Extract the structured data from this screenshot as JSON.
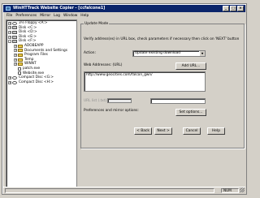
{
  "window": {
    "title": "WinHTTrack Website Copier - [ccfalcone1]"
  },
  "menu": [
    "File",
    "Preferences",
    "Mirror",
    "Log",
    "Window",
    "Help"
  ],
  "tree": [
    {
      "label": "3½ Floppy <A:>",
      "level": 0,
      "toggle": "+",
      "icon": "floppy",
      "selected": false
    },
    {
      "label": "Disk <C:>",
      "level": 0,
      "toggle": "+",
      "icon": "drive",
      "selected": false
    },
    {
      "label": "Disk <D:>",
      "level": 0,
      "toggle": "+",
      "icon": "drive",
      "selected": false
    },
    {
      "label": "Disk <E:>",
      "level": 0,
      "toggle": "+",
      "icon": "drive",
      "selected": false
    },
    {
      "label": "Disk <F:>",
      "level": 0,
      "toggle": "-",
      "icon": "drive",
      "selected": false
    },
    {
      "label": "ADOBEAPP",
      "level": 1,
      "toggle": "+",
      "icon": "folder",
      "selected": false
    },
    {
      "label": "Documents and Settings",
      "level": 1,
      "toggle": "+",
      "icon": "folder",
      "selected": false
    },
    {
      "label": "Program Files",
      "level": 1,
      "toggle": "+",
      "icon": "folder",
      "selected": false
    },
    {
      "label": "Temp",
      "level": 1,
      "toggle": "+",
      "icon": "folder",
      "selected": false
    },
    {
      "label": "WINNT",
      "level": 1,
      "toggle": "+",
      "icon": "folder",
      "selected": false
    },
    {
      "label": "patch.exe",
      "level": 1,
      "toggle": "",
      "icon": "file",
      "selected": false
    },
    {
      "label": "Website.exe",
      "level": 1,
      "toggle": "",
      "icon": "file",
      "selected": false
    },
    {
      "label": "Compact Disc <G:>",
      "level": 0,
      "toggle": "+",
      "icon": "cd",
      "selected": false
    },
    {
      "label": "Compact Disc <H:>",
      "level": 0,
      "toggle": "+",
      "icon": "cd",
      "selected": false
    }
  ],
  "form": {
    "group_title": "Update Mode",
    "hint": "Verify address(es) in URL box, check parameters if necessary then click on 'NEXT' button",
    "action_label": "Action:",
    "action_value": "Update existing download",
    "web_addresses_label": "Web Addresses: (URL)",
    "add_url_label": "Add URL...",
    "url_text": "http://www.geocities.com/falcon_gwn/",
    "url_list_label": "URL list (.txt):",
    "prefs_label": "Preferences and mirror options:",
    "set_options_label": "Set options..."
  },
  "buttons": {
    "back": "< Back",
    "next": "Next >",
    "cancel": "Cancel",
    "help": "Help"
  },
  "status": {
    "num": "NUM"
  }
}
